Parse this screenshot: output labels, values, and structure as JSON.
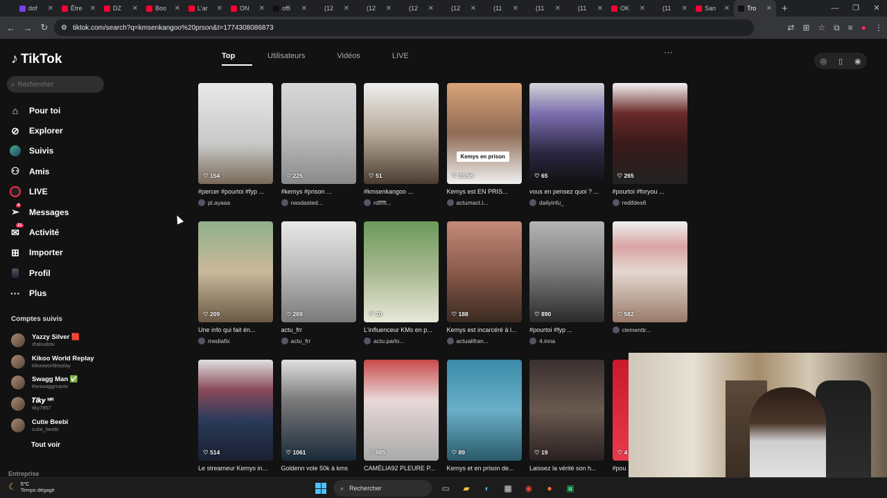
{
  "browser": {
    "tabs": [
      {
        "title": "dof",
        "color": "#7b3fe4"
      },
      {
        "title": "Être",
        "color": "#ff0033"
      },
      {
        "title": "DZ",
        "color": "#ff0033"
      },
      {
        "title": "Boo",
        "color": "#ff0033"
      },
      {
        "title": "L'ar",
        "color": "#ff0033"
      },
      {
        "title": "ON",
        "color": "#ff0033"
      },
      {
        "title": "offi",
        "color": "#111111"
      },
      {
        "title": "(12",
        "color": "#222222"
      },
      {
        "title": "(12",
        "color": "#222222"
      },
      {
        "title": "(12",
        "color": "#222222"
      },
      {
        "title": "(12",
        "color": "#222222"
      },
      {
        "title": "(11",
        "color": "#222222"
      },
      {
        "title": "(11",
        "color": "#222222"
      },
      {
        "title": "(11",
        "color": "#222222"
      },
      {
        "title": "OK",
        "color": "#ff0033"
      },
      {
        "title": "(11",
        "color": "#222222"
      },
      {
        "title": "San",
        "color": "#ff0033"
      },
      {
        "title": "Tro",
        "color": "#111111",
        "active": true
      }
    ],
    "new_tab": "+",
    "url": "tiktok.com/search?q=kmsenkangoo%20prson&t=1774308086873"
  },
  "sidebar": {
    "logo": "TikTok",
    "search_placeholder": "Rechercher",
    "nav": [
      {
        "label": "Pour toi",
        "icon": "home-icon"
      },
      {
        "label": "Explorer",
        "icon": "compass-icon"
      },
      {
        "label": "Suivis",
        "icon": "avatar-icon"
      },
      {
        "label": "Amis",
        "icon": "friends-icon"
      },
      {
        "label": "LIVE",
        "icon": "live-icon"
      },
      {
        "label": "Messages",
        "icon": "send-icon",
        "badge": "4"
      },
      {
        "label": "Activité",
        "icon": "activity-icon",
        "badge": "31"
      },
      {
        "label": "Importer",
        "icon": "plus-square-icon"
      },
      {
        "label": "Profil",
        "icon": "profile-icon"
      },
      {
        "label": "Plus",
        "icon": "more-icon"
      }
    ],
    "follows_title": "Comptes suivis",
    "follows": [
      {
        "name": "Yazzy Silver 🟥",
        "handle": "drakudotv"
      },
      {
        "name": "Kikoo World Replay",
        "handle": "kikooworldreplay"
      },
      {
        "name": "Swagg Man ✅",
        "handle": "theswaggmantv"
      },
      {
        "name": "𝑻𝒊𝒌𝒚 ᴹᴿ",
        "handle": "tiky7857"
      },
      {
        "name": "Cutie Beebi",
        "handle": "cutie_beebi"
      }
    ],
    "see_all": "Tout voir",
    "entreprise": "Entreprise"
  },
  "search_tabs": [
    "Top",
    "Utilisateurs",
    "Vidéos",
    "LIVE"
  ],
  "more_label": "···",
  "videos": [
    {
      "likes": "154",
      "desc": "#percer #pourtoi #fyp ...",
      "author": "pl.ayaaa",
      "bg": "linear-gradient(#e8e8e8,#c9c9c9 60%,#7a6a5a)"
    },
    {
      "likes": "225",
      "desc": "#kemys #prison ...",
      "author": "nasdasted...",
      "bg": "linear-gradient(#d8d8d8,#bdbdbd 50%,#8a8a8a)"
    },
    {
      "likes": "51",
      "desc": "#kmsenkangoo ...",
      "author": "rdfffft...",
      "bg": "linear-gradient(#efefef,#b8aa9a 50%,#4a3c30)"
    },
    {
      "likes": "23.5K",
      "desc": "Kemys est EN PRIS...",
      "author": "actumact.i...",
      "bg": "linear-gradient(#d9a47a,#8f6b55 50%,#f0f0f0)",
      "caption": "Kemys en prison"
    },
    {
      "likes": "65",
      "desc": "vous en pensez quoi ? ...",
      "author": "dailyinfu_",
      "bg": "linear-gradient(#d5d5d5,#7c6fb0 30%,#2b2540 70%,#111)"
    },
    {
      "likes": "265",
      "desc": "#pourtoi #foryou ...",
      "author": "redifdes6",
      "bg": "linear-gradient(#f3f3f3,#6a2a2a 30%,#3a1a1a 60%,#222)"
    },
    {
      "likes": "209",
      "desc": "Une info qui fait én...",
      "author": "mediafix",
      "bg": "linear-gradient(#8fb08a,#c9b89a 50%,#6a5a45)"
    },
    {
      "likes": "269",
      "desc": "actu_frr",
      "author": "actu_frr",
      "bg": "linear-gradient(#e8e8e8,#b8b8b8 50%,#7a7a7a)"
    },
    {
      "likes": "20",
      "desc": "L'influenceur KMs en p...",
      "author": "actu.parlo...",
      "bg": "linear-gradient(#6a9a5a,#a8b890 50%,#e8e8d8)"
    },
    {
      "likes": "188",
      "desc": "Kemys est incarcéré à l...",
      "author": "actualifran...",
      "bg": "linear-gradient(#c48a7a,#8a5a4a 50%,#3a2a22)"
    },
    {
      "likes": "890",
      "desc": "#pourtoi #fyp ...",
      "author": "4.inna",
      "bg": "linear-gradient(#b5b5b5,#7a7a7a 50%,#2a2a2a)"
    },
    {
      "likes": "582",
      "desc": "",
      "author": "clementtr...",
      "bg": "linear-gradient(#f0f0f0,#d9a4a4 25%,#e4d8d0 50%,#9a7a6a)"
    },
    {
      "likes": "514",
      "desc": "Le streameur Kemys in...",
      "author": "",
      "bg": "linear-gradient(#e0e0e0,#8a4a5a 30%,#2a3a5a 60%,#1a2030)"
    },
    {
      "likes": "1061",
      "desc": "Goldenn vole 50k à kms",
      "author": "",
      "bg": "linear-gradient(#e0e0e0,#7a7a7a 40%,#1a2a3a)"
    },
    {
      "likes": "985",
      "desc": "CAMÉLIA92 PLEURE P...",
      "author": "",
      "bg": "linear-gradient(#c84a4a,#e8d8d8 40%,#aaaaaa)"
    },
    {
      "likes": "89",
      "desc": "Kemys et en prison de...",
      "author": "",
      "bg": "linear-gradient(#3a8aa8,#6ab0c8 50%,#2a5a6a)"
    },
    {
      "likes": "19",
      "desc": "Laissez la vérité son h...",
      "author": "",
      "bg": "linear-gradient(#3a3030,#6a5a50 50%,#2a2020)"
    },
    {
      "likes": "4",
      "desc": "#pou",
      "author": "",
      "bg": "linear-gradient(#c81a2a,#e83a4a)"
    }
  ],
  "taskbar": {
    "temp": "5°C",
    "weather": "Temps dégagé",
    "search": "Rechercher"
  }
}
